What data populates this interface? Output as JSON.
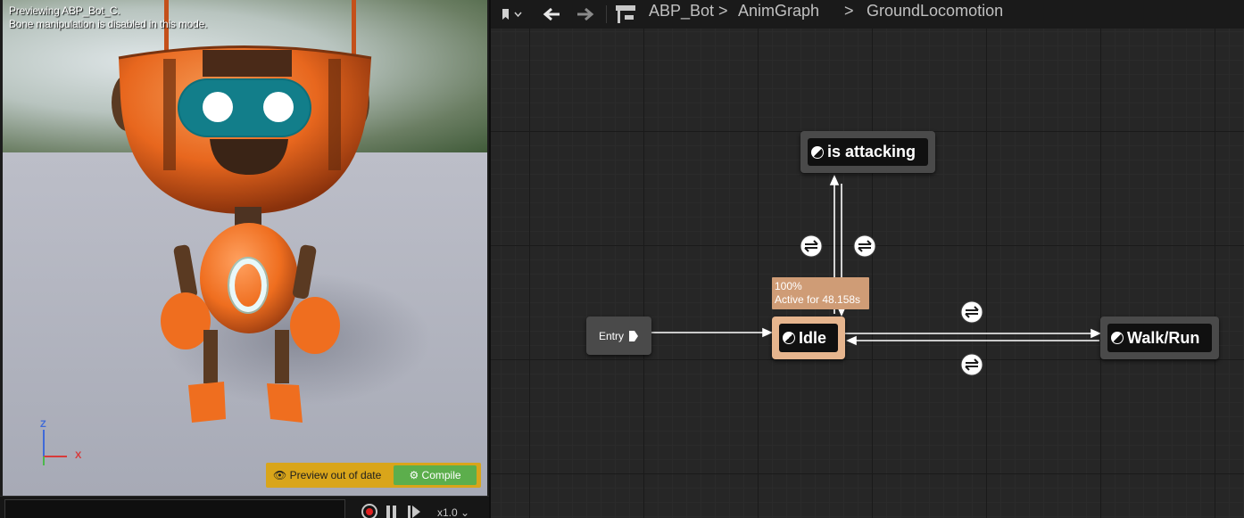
{
  "viewport": {
    "preview_line1": "Previewing ABP_Bot_C.",
    "preview_line2": "Bone manipulation is disabled in this mode.",
    "axis": {
      "z": "Z",
      "x": "X"
    },
    "preview_out_of_date": "Preview out of date",
    "compile_label": "Compile",
    "playback_speed": "x1.0"
  },
  "toolbar": {
    "bookmark_icon": "bookmark-icon",
    "back_icon": "arrow-left-icon",
    "forward_icon": "arrow-right-icon",
    "hierarchy_icon": "hierarchy-icon"
  },
  "breadcrumb": {
    "items": [
      "ABP_Bot",
      "AnimGraph",
      "GroundLocomotion"
    ],
    "separator": ">"
  },
  "graph": {
    "entry_label": "Entry",
    "states": {
      "idle": "Idle",
      "attacking": "is attacking",
      "walk_run": "Walk/Run"
    },
    "active_state": {
      "percent": "100%",
      "active_for": "Active for 48.158s"
    }
  },
  "colors": {
    "graph_bg": "#262626",
    "node_bg": "#4a4a4a",
    "active_node": "#e6b58e",
    "tooltip_bg": "#cf9c76",
    "compile_green": "#5cae4c",
    "warning_yellow": "#d9a51a",
    "robot_orange": "#e8671e"
  }
}
